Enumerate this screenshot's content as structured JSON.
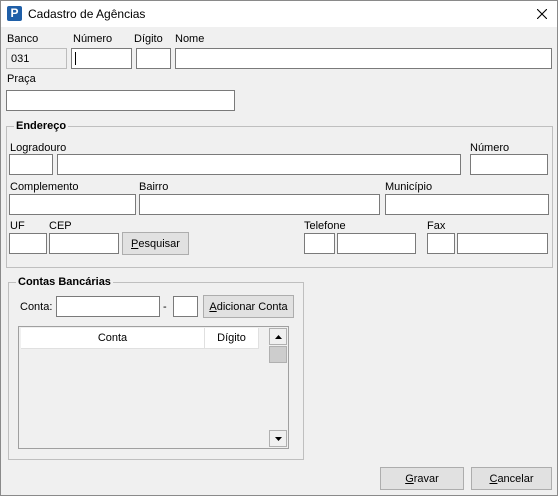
{
  "window": {
    "title": "Cadastro de Agências"
  },
  "agencia": {
    "banco_label": "Banco",
    "banco_value": "031",
    "numero_label": "Número",
    "digito_label": "Dígito",
    "nome_label": "Nome",
    "praca_label": "Praça"
  },
  "endereco": {
    "title": "Endereço",
    "logradouro_label": "Logradouro",
    "numero_label": "Número",
    "complemento_label": "Complemento",
    "bairro_label": "Bairro",
    "municipio_label": "Município",
    "uf_label": "UF",
    "cep_label": "CEP",
    "pesquisar_label_first": "P",
    "pesquisar_label_rest": "esquisar",
    "telefone_label": "Telefone",
    "fax_label": "Fax"
  },
  "contas": {
    "title": "Contas Bancárias",
    "conta_label": "Conta:",
    "separator": "-",
    "add_label_first": "A",
    "add_label_rest": "dicionar Conta",
    "columns": [
      "Conta",
      "Dígito"
    ]
  },
  "footer": {
    "gravar_first": "G",
    "gravar_rest": "ravar",
    "cancelar_first": "C",
    "cancelar_rest": "ancelar"
  }
}
